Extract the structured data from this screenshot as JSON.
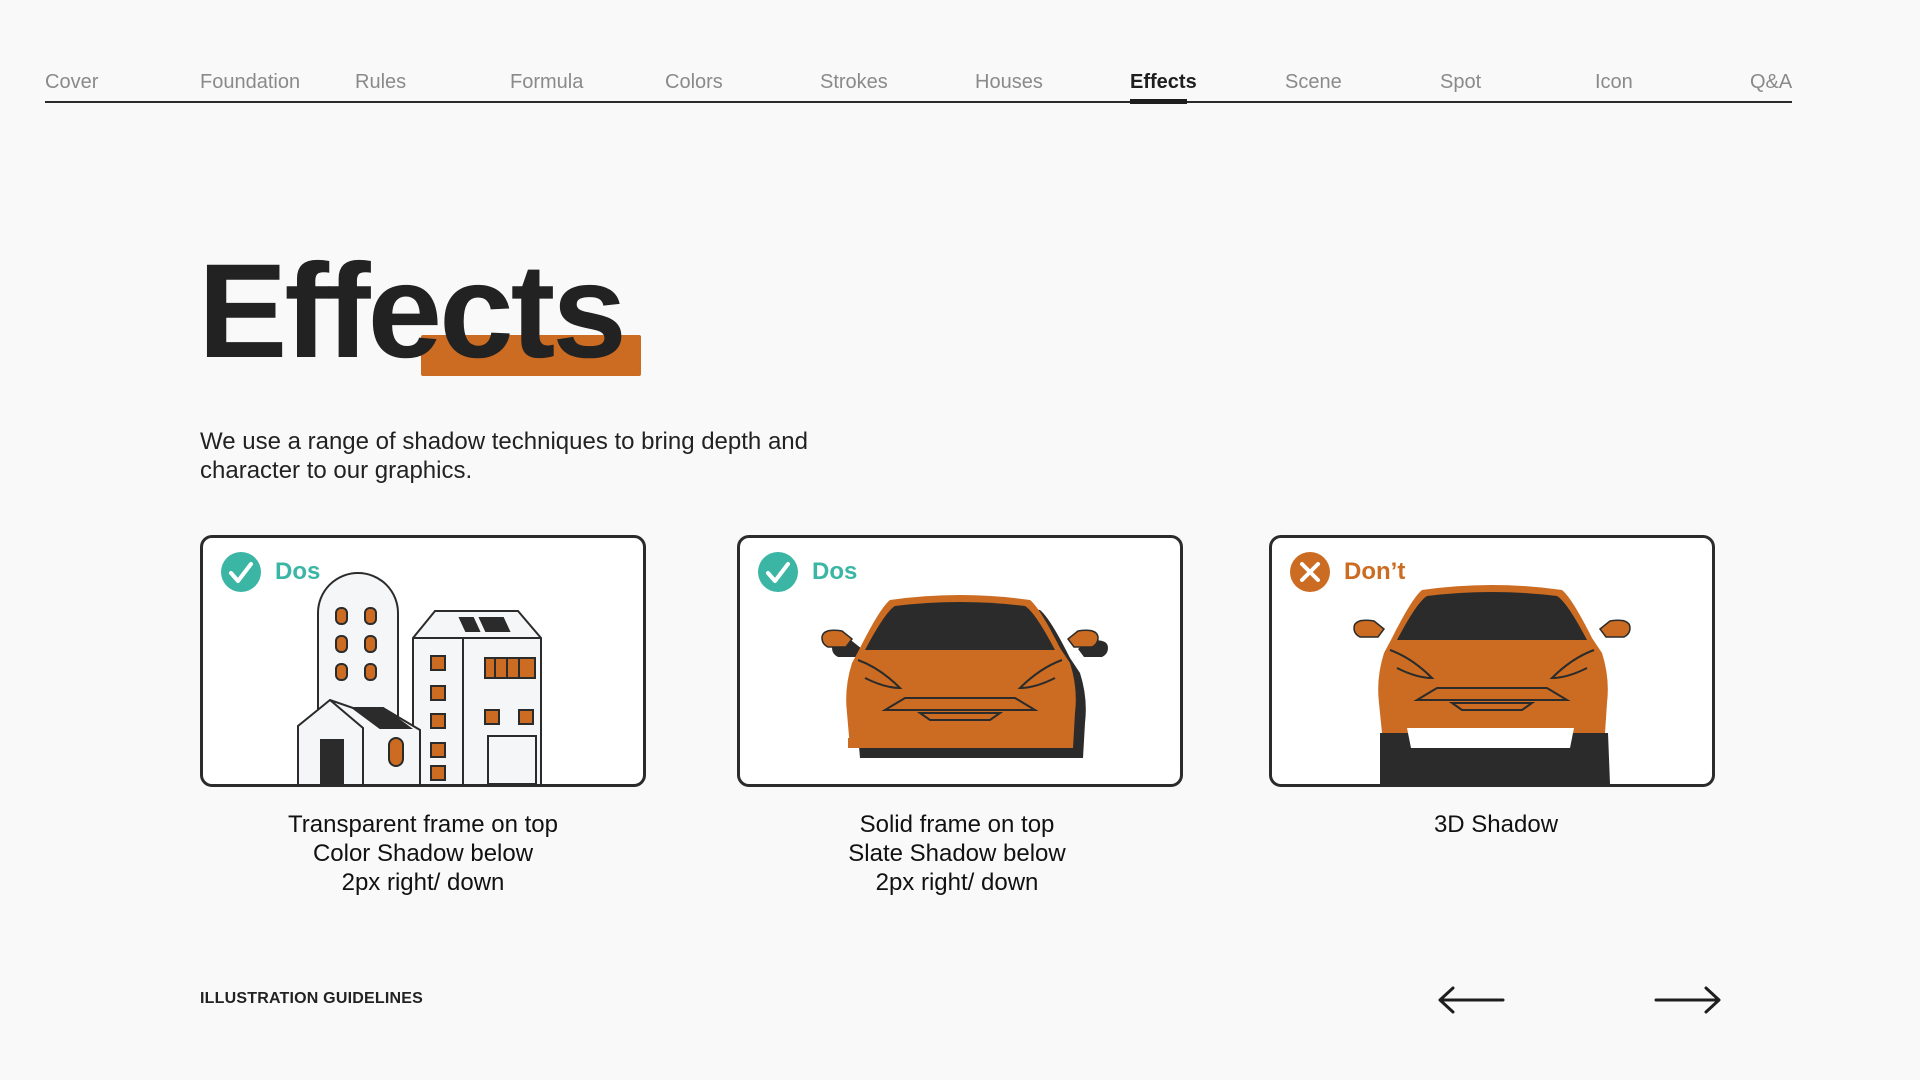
{
  "nav": {
    "tabs": [
      {
        "label": "Cover"
      },
      {
        "label": "Foundation"
      },
      {
        "label": "Rules"
      },
      {
        "label": "Formula"
      },
      {
        "label": "Colors"
      },
      {
        "label": "Strokes"
      },
      {
        "label": "Houses"
      },
      {
        "label": "Effects",
        "active": true
      },
      {
        "label": "Scene"
      },
      {
        "label": "Spot"
      },
      {
        "label": "Icon"
      },
      {
        "label": "Q&A"
      }
    ]
  },
  "page": {
    "title": "Effects",
    "description_lines": [
      "We use a range of shadow techniques to bring depth and",
      "character to our graphics."
    ]
  },
  "cards": [
    {
      "badge": "Dos",
      "badge_type": "check-icon",
      "caption_lines": [
        "Transparent frame on top",
        "Color Shadow below",
        "2px right/ down"
      ]
    },
    {
      "badge": "Dos",
      "badge_type": "check-icon",
      "caption_lines": [
        "Solid frame on top",
        "Slate Shadow below",
        "2px right/ down"
      ]
    },
    {
      "badge": "Don’t",
      "badge_type": "cross-icon",
      "caption_lines": [
        "3D Shadow"
      ]
    }
  ],
  "footer": {
    "label": "ILLUSTRATION GUIDELINES",
    "prev_icon": "arrow-left-icon",
    "next_icon": "arrow-right-icon"
  },
  "colors": {
    "accent_orange": "#cb6c22",
    "accent_teal": "#3bb5a4",
    "slate": "#2b2b2b",
    "background": "#f9f9f9"
  }
}
